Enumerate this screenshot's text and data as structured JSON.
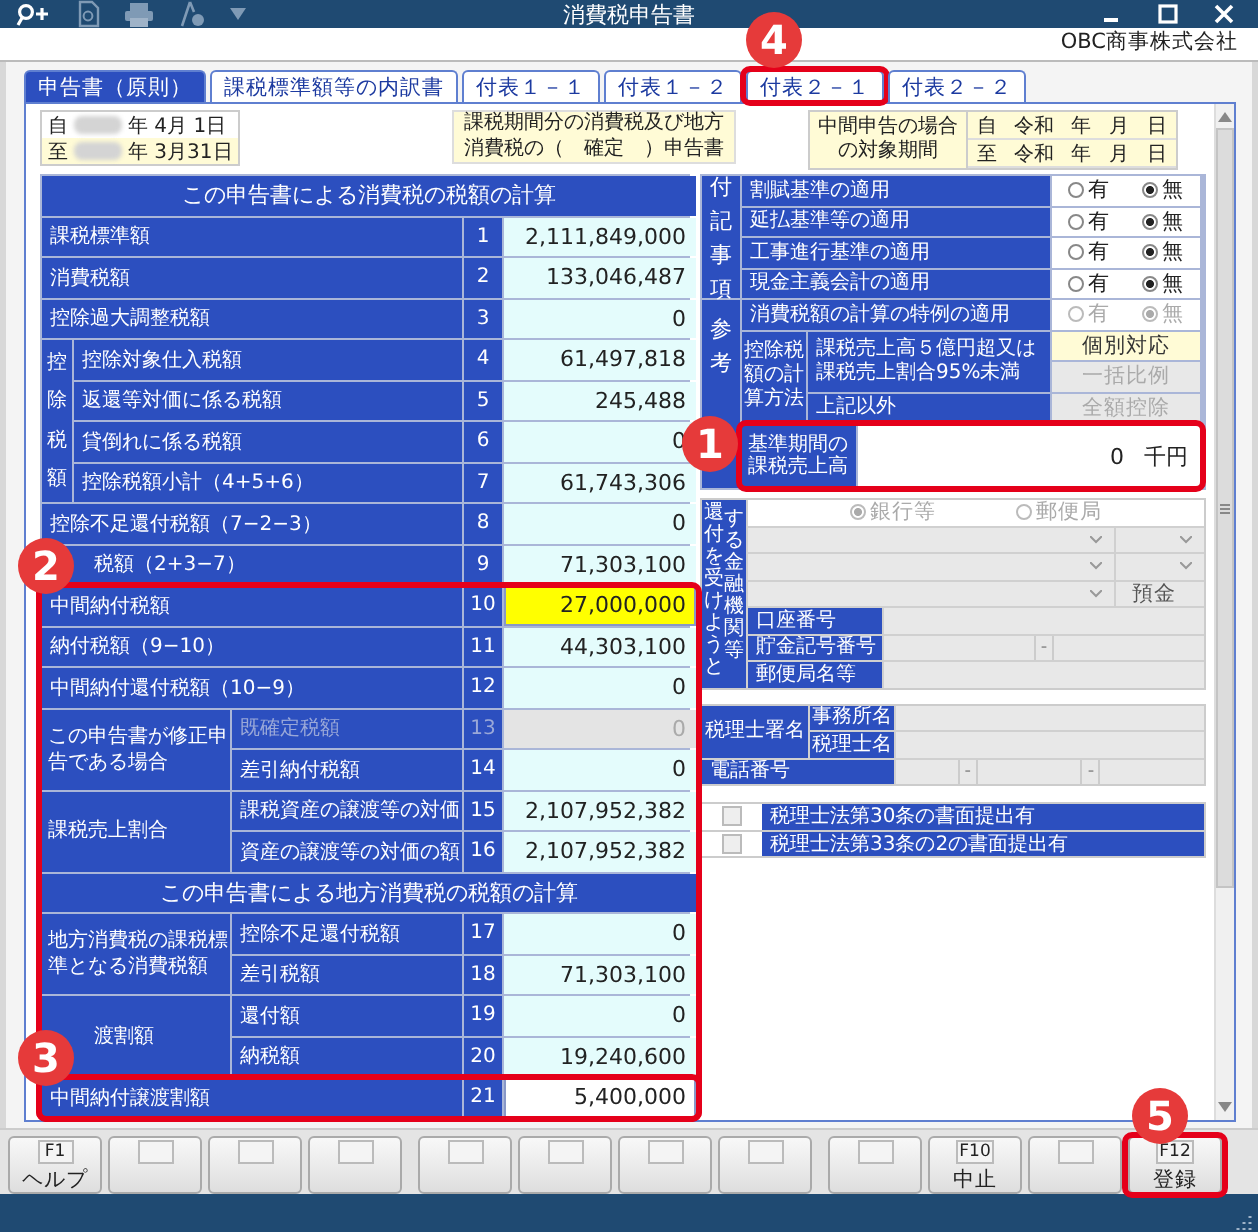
{
  "window": {
    "title": "消費税申告書"
  },
  "company": "OBC商事株式会社",
  "tabs": [
    {
      "label": "申告書（原則）",
      "selected": true
    },
    {
      "label": "課税標準額等の内訳書",
      "selected": false
    },
    {
      "label": "付表１－１",
      "selected": false
    },
    {
      "label": "付表１－２",
      "selected": false
    },
    {
      "label": "付表２－１",
      "selected": false,
      "callout": "4"
    },
    {
      "label": "付表２－２",
      "selected": false
    }
  ],
  "period": [
    {
      "label": "自",
      "date": "年  4月  1日"
    },
    {
      "label": "至",
      "date": "年  3月31日"
    }
  ],
  "form_title": [
    "課税期間分の消費税及び地方",
    "消費税の（　確定　）申告書"
  ],
  "interim": {
    "label": [
      "中間申告の場合",
      "の対象期間"
    ],
    "rows": [
      [
        "自",
        "令和",
        "年",
        "月",
        "日"
      ],
      [
        "至",
        "令和",
        "年",
        "月",
        "日"
      ]
    ]
  },
  "calc": [
    {
      "title": "この申告書による消費税の税額の計算",
      "rows": [
        {
          "kind": "row",
          "no": "1",
          "label": "課税標準額",
          "value": "2,111,849,000",
          "editable": false,
          "highlighted": false,
          "disabled": false
        },
        {
          "kind": "row",
          "no": "2",
          "label": "消費税額",
          "value": "133,046,487",
          "editable": false,
          "highlighted": false,
          "disabled": false
        },
        {
          "kind": "row",
          "no": "3",
          "label": "控除過大調整税額",
          "value": "0",
          "editable": false,
          "highlighted": false,
          "disabled": false
        },
        {
          "kind": "band",
          "label": "控除税額",
          "rows": [
            {
              "no": "4",
              "label": "控除対象仕入税額",
              "value": "61,497,818",
              "editable": false,
              "highlighted": false,
              "disabled": false
            },
            {
              "no": "5",
              "label": "返還等対価に係る税額",
              "value": "245,488",
              "editable": false,
              "highlighted": false,
              "disabled": false
            },
            {
              "no": "6",
              "label": "貸倒れに係る税額",
              "value": "0",
              "editable": false,
              "highlighted": false,
              "disabled": false
            },
            {
              "no": "7",
              "label": "控除税額小計（4+5+6）",
              "value": "61,743,306",
              "editable": false,
              "highlighted": false,
              "disabled": false
            }
          ]
        },
        {
          "kind": "row",
          "no": "8",
          "label": "控除不足還付税額（7−2−3）",
          "value": "0",
          "editable": false,
          "highlighted": false,
          "disabled": false
        },
        {
          "kind": "row",
          "no": "9",
          "label": "税額（2+3−7）",
          "value": "71,303,100",
          "editable": false,
          "highlighted": false,
          "disabled": false
        },
        {
          "kind": "row",
          "no": "10",
          "label": "中間納付税額",
          "value": "27,000,000",
          "editable": true,
          "highlighted": true,
          "disabled": false,
          "callout": "2"
        },
        {
          "kind": "row",
          "no": "11",
          "label": "納付税額（9−10）",
          "value": "44,303,100",
          "editable": false,
          "highlighted": false,
          "disabled": false
        },
        {
          "kind": "row",
          "no": "12",
          "label": "中間納付還付税額（10−9）",
          "value": "0",
          "editable": false,
          "highlighted": false,
          "disabled": false
        },
        {
          "kind": "group",
          "label": "この申告書が修正申告である場合",
          "rows": [
            {
              "no": "13",
              "label": "既確定税額",
              "value": "0",
              "editable": false,
              "highlighted": false,
              "disabled": true
            },
            {
              "no": "14",
              "label": "差引納付税額",
              "value": "0",
              "editable": false,
              "highlighted": false,
              "disabled": false
            }
          ]
        },
        {
          "kind": "group",
          "label": "課税売上割合",
          "rows": [
            {
              "no": "15",
              "label": "課税資産の譲渡等の対価",
              "value": "2,107,952,382",
              "editable": false,
              "highlighted": false,
              "disabled": false
            },
            {
              "no": "16",
              "label": "資産の譲渡等の対価の額",
              "value": "2,107,952,382",
              "editable": false,
              "highlighted": false,
              "disabled": false
            }
          ]
        }
      ]
    },
    {
      "title": "この申告書による地方消費税の税額の計算",
      "rows": [
        {
          "kind": "group",
          "label": "地方消費税の課税標準となる消費税額",
          "rows": [
            {
              "no": "17",
              "label": "控除不足還付税額",
              "value": "0",
              "editable": false,
              "highlighted": false,
              "disabled": false
            },
            {
              "no": "18",
              "label": "差引税額",
              "value": "71,303,100",
              "editable": false,
              "highlighted": false,
              "disabled": false
            }
          ]
        },
        {
          "kind": "group",
          "label": "渡割額",
          "rows": [
            {
              "no": "19",
              "label": "還付額",
              "value": "0",
              "editable": false,
              "highlighted": false,
              "disabled": false
            },
            {
              "no": "20",
              "label": "納税額",
              "value": "19,240,600",
              "editable": false,
              "highlighted": false,
              "disabled": false
            }
          ]
        },
        {
          "kind": "row",
          "no": "21",
          "label": "中間納付譲渡割額",
          "value": "5,400,000",
          "editable": true,
          "highlighted": false,
          "disabled": false,
          "callout": "3"
        }
      ]
    }
  ],
  "notes": {
    "label": "付記事項",
    "rows": [
      {
        "label": "割賦基準の適用",
        "options": [
          {
            "label": "有",
            "selected": false
          },
          {
            "label": "無",
            "selected": true
          }
        ]
      },
      {
        "label": "延払基準等の適用",
        "options": [
          {
            "label": "有",
            "selected": false
          },
          {
            "label": "無",
            "selected": true
          }
        ]
      },
      {
        "label": "工事進行基準の適用",
        "options": [
          {
            "label": "有",
            "selected": false
          },
          {
            "label": "無",
            "selected": true
          }
        ]
      },
      {
        "label": "現金主義会計の適用",
        "options": [
          {
            "label": "有",
            "selected": false
          },
          {
            "label": "無",
            "selected": true
          }
        ]
      }
    ]
  },
  "reference": {
    "label": "参考",
    "special": {
      "label": "消費税額の計算の特例の適用",
      "disabled": true,
      "options": [
        {
          "label": "有",
          "selected": false
        },
        {
          "label": "無",
          "selected": true
        }
      ]
    },
    "method": {
      "label": "控除税額の計算方法",
      "cases": [
        {
          "label": "課税売上高５億円超又は課税売上割合95%未満",
          "options": [
            {
              "label": "個別対応",
              "selected": true
            },
            {
              "label": "一括比例",
              "selected": false
            }
          ]
        },
        {
          "label": "上記以外",
          "options": [
            {
              "label": "全額控除",
              "selected": false
            }
          ]
        }
      ]
    },
    "basis": {
      "label": "基準期間の課税売上高",
      "value": "0",
      "unit": "千円",
      "callout": "1"
    }
  },
  "refund": {
    "label_columns": [
      "還付を受けようと",
      "する金融機関等"
    ],
    "disabled": true,
    "options": [
      {
        "label": "銀行等",
        "selected": true
      },
      {
        "label": "郵便局",
        "selected": false
      }
    ],
    "deposit_type": "預金",
    "fields": [
      {
        "label": "口座番号"
      },
      {
        "label": "貯金記号番号",
        "separator": "-"
      },
      {
        "label": "郵便局名等"
      }
    ]
  },
  "accountant": {
    "label": "税理士署名",
    "rows": [
      "事務所名",
      "税理士名"
    ],
    "phone_label": "電話番号",
    "phone_separators": [
      "-",
      "-"
    ]
  },
  "filings": [
    {
      "label": "税理士法第30条の書面提出有",
      "checked": false
    },
    {
      "label": "税理士法第33条の2の書面提出有",
      "checked": false
    }
  ],
  "function_keys": [
    {
      "kind": "key",
      "key": "F1",
      "label": "ヘルプ"
    },
    {
      "kind": "blank"
    },
    {
      "kind": "blank"
    },
    {
      "kind": "blank"
    },
    {
      "kind": "blank"
    },
    {
      "kind": "blank"
    },
    {
      "kind": "blank"
    },
    {
      "kind": "blank"
    },
    {
      "kind": "blank"
    },
    {
      "kind": "key",
      "key": "F10",
      "label": "中止"
    },
    {
      "kind": "blank"
    },
    {
      "kind": "key",
      "key": "F12",
      "label": "登録",
      "callout": "5"
    }
  ]
}
